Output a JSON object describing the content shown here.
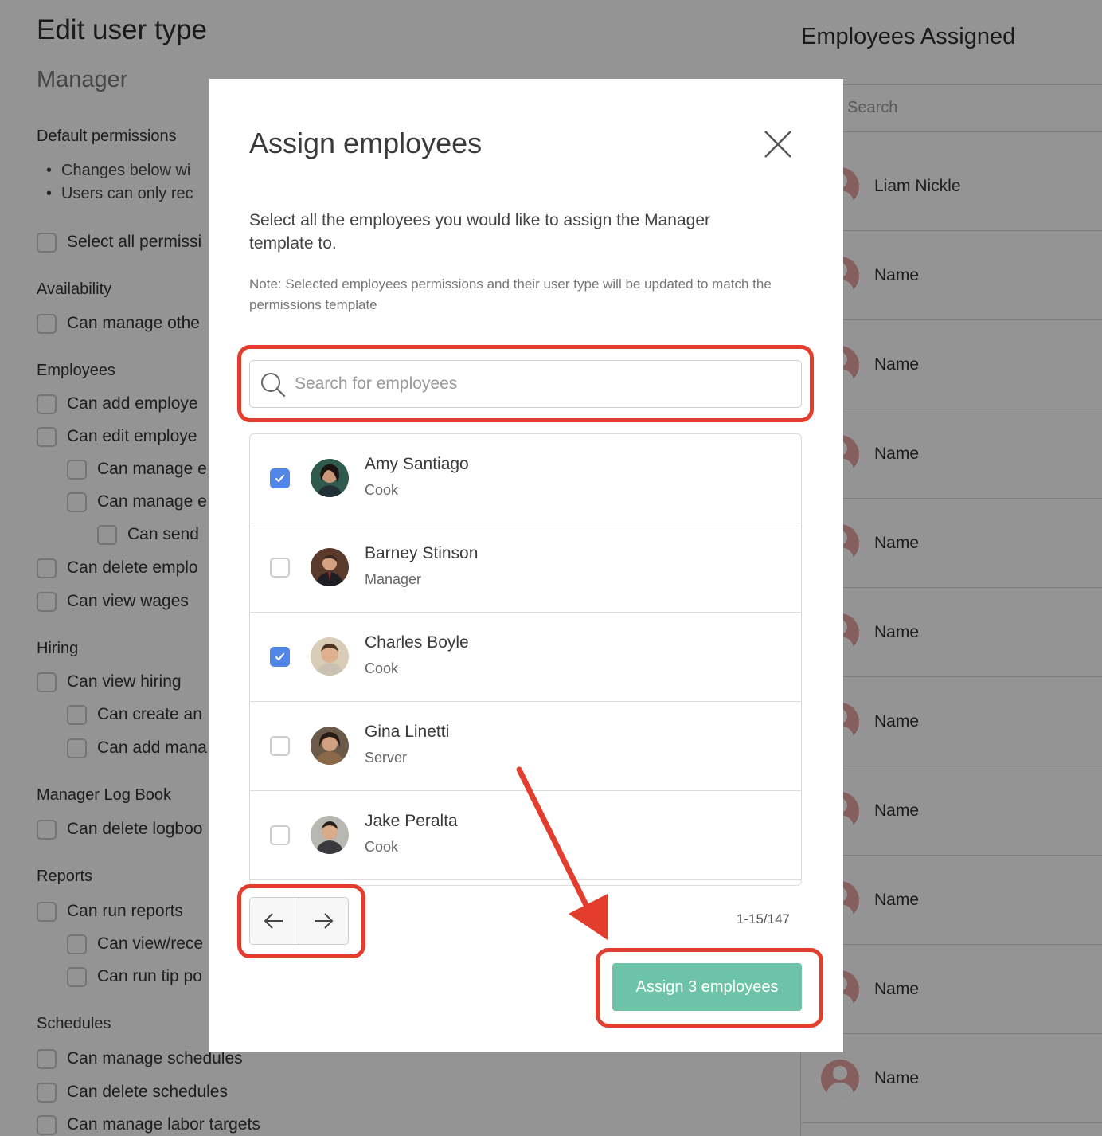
{
  "background": {
    "title": "Edit user type",
    "subtitle": "Manager",
    "sections": {
      "default": "Default permissions",
      "availability": "Availability",
      "employees": "Employees",
      "hiring": "Hiring",
      "logbook": "Manager Log Book",
      "reports": "Reports",
      "schedules": "Schedules"
    },
    "bullets": [
      "Changes below wi",
      "Users can only rec"
    ],
    "permissions": {
      "select_all": "Select all permissi",
      "manage_other": "Can manage othe",
      "add_employee": "Can add employe",
      "edit_employee": "Can edit employe",
      "manage_e1": "Can manage e",
      "manage_e2": "Can manage e",
      "can_send": "Can send",
      "delete_employee": "Can delete emplo",
      "view_wages": "Can view wages",
      "view_hiring": "Can view hiring",
      "create_an": "Can create an",
      "add_mana": "Can add mana",
      "delete_logbook": "Can delete logboo",
      "run_reports": "Can run reports",
      "view_rece": "Can view/rece",
      "run_tip": "Can run tip po",
      "manage_schedules": "Can manage schedules",
      "delete_schedules": "Can delete schedules",
      "manage_labor": "Can manage labor targets"
    },
    "right": {
      "title": "Employees Assigned",
      "search_placeholder": "Search",
      "employees": [
        "Liam Nickle",
        "Name",
        "Name",
        "Name",
        "Name",
        "Name",
        "Name",
        "Name",
        "Name",
        "Name",
        "Name"
      ]
    }
  },
  "modal": {
    "title": "Assign employees",
    "description": "Select all the employees you would like to assign the Manager template to.",
    "note": "Note: Selected employees permissions and their user type will be updated to match the permissions template",
    "search_placeholder": "Search for employees",
    "employees": [
      {
        "name": "Amy Santiago",
        "role": "Cook",
        "checked": true
      },
      {
        "name": "Barney Stinson",
        "role": "Manager",
        "checked": false
      },
      {
        "name": "Charles Boyle",
        "role": "Cook",
        "checked": true
      },
      {
        "name": "Gina Linetti",
        "role": "Server",
        "checked": false
      },
      {
        "name": "Jake Peralta",
        "role": "Cook",
        "checked": false
      }
    ],
    "pagination": "1-15/147",
    "assign_label": "Assign 3 employees"
  },
  "colors": {
    "checkbox_checked": "#4f86e8",
    "assign_button": "#6cc3a8",
    "highlight": "#e23d2d",
    "avatar_placeholder": "#e6a3a3"
  },
  "icons": [
    "close-icon",
    "search-icon",
    "check-icon",
    "arrow-left-icon",
    "arrow-right-icon",
    "avatar-placeholder-icon"
  ]
}
